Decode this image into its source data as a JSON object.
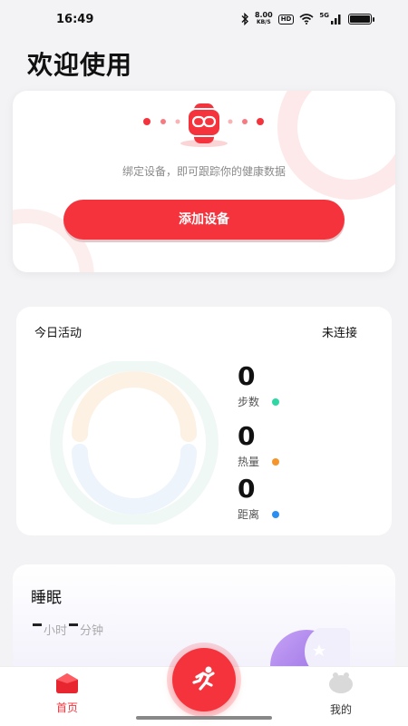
{
  "status_bar": {
    "time": "16:49",
    "net_speed_value": "8.00",
    "net_speed_unit": "KB/S",
    "hd_label": "HD",
    "signal_label": "5G"
  },
  "page_title": "欢迎使用",
  "device_card": {
    "hint": "绑定设备，即可跟踪你的健康数据",
    "add_button": "添加设备"
  },
  "activity": {
    "title": "今日活动",
    "status": "未连接",
    "metrics": [
      {
        "value": "0",
        "label": "步数",
        "color": "#2fd7a4"
      },
      {
        "value": "0",
        "label": "热量",
        "color": "#f5962d"
      },
      {
        "value": "0",
        "label": "距离",
        "color": "#2b8ff2"
      }
    ]
  },
  "sleep": {
    "title": "睡眠",
    "hours_unit": "小时",
    "minutes_unit": "分钟"
  },
  "tab_bar": {
    "home_label": "首页",
    "mine_label": "我的"
  },
  "colors": {
    "accent": "#f5333c",
    "background": "#f3f3f5"
  }
}
